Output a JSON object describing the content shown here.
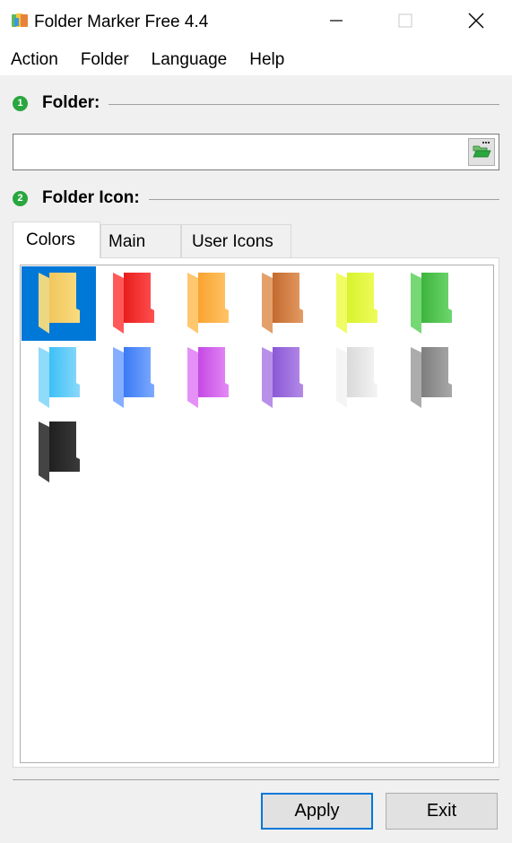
{
  "window": {
    "title": "Folder Marker Free 4.4",
    "app_icon": "folder-marker-app-icon",
    "controls": {
      "minimize": "minimize-icon",
      "maximize": "maximize-icon",
      "close": "close-icon"
    }
  },
  "menu": {
    "items": [
      {
        "label": "Action"
      },
      {
        "label": "Folder"
      },
      {
        "label": "Language"
      },
      {
        "label": "Help"
      }
    ]
  },
  "folder_section": {
    "number": "1",
    "label": "Folder:",
    "path_value": "",
    "browse_icon": "open-folder-browse-icon"
  },
  "icon_section": {
    "number": "2",
    "label": "Folder Icon:",
    "tabs": [
      {
        "label": "Colors",
        "active": true
      },
      {
        "label": "Main",
        "active": false
      },
      {
        "label": "User Icons",
        "active": false
      }
    ],
    "colors": [
      {
        "name": "default-yellow",
        "front": "#f9dc7e",
        "back": "#f1c65e",
        "selected": true
      },
      {
        "name": "red",
        "front": "#ff5050",
        "back": "#e81c1c",
        "selected": false
      },
      {
        "name": "orange",
        "front": "#ffc468",
        "back": "#f9a430",
        "selected": false
      },
      {
        "name": "brown",
        "front": "#e39b62",
        "back": "#c46a2e",
        "selected": false
      },
      {
        "name": "lime",
        "front": "#eefc5c",
        "back": "#d8f22e",
        "selected": false
      },
      {
        "name": "green",
        "front": "#6ed66e",
        "back": "#3db43d",
        "selected": false
      },
      {
        "name": "light-blue",
        "front": "#8ad8fa",
        "back": "#3cc0f6",
        "selected": false
      },
      {
        "name": "blue",
        "front": "#7eaaff",
        "back": "#3a7af5",
        "selected": false
      },
      {
        "name": "magenta",
        "front": "#e48af5",
        "back": "#c44ae4",
        "selected": false
      },
      {
        "name": "purple",
        "front": "#b48ae8",
        "back": "#8a58d6",
        "selected": false
      },
      {
        "name": "white",
        "front": "#f4f4f4",
        "back": "#d9d9d9",
        "selected": false
      },
      {
        "name": "gray",
        "front": "#a8a8a8",
        "back": "#7e7e7e",
        "selected": false
      },
      {
        "name": "black",
        "front": "#3a3a3a",
        "back": "#202020",
        "selected": false
      }
    ]
  },
  "buttons": {
    "apply": "Apply",
    "exit": "Exit"
  },
  "colors": {
    "accent": "#0078d7",
    "badge": "#2aa63e"
  }
}
